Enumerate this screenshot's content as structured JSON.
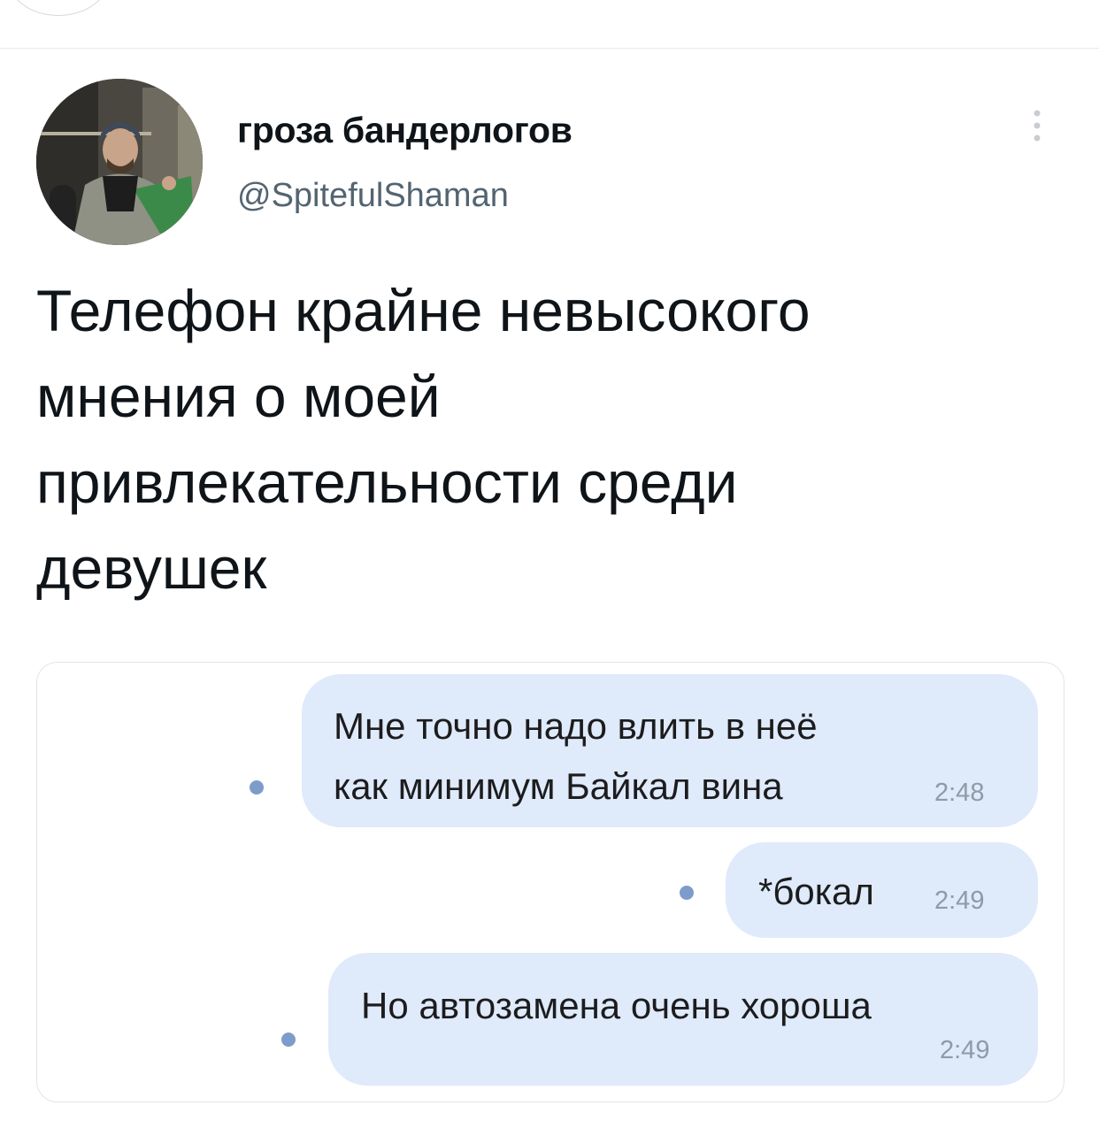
{
  "tweet": {
    "author": {
      "display_name": "гроза бандерлогов",
      "handle": "@SpitefulShaman"
    },
    "text_lines": [
      "Телефон крайне невысокого",
      "мнения о моей",
      "привлекательности среди",
      "девушек"
    ],
    "more_icon": "more-vertical-icon"
  },
  "chat": {
    "bubble_color": "#dfeafa",
    "dot_color": "#7d9ccb",
    "messages": [
      {
        "lines": [
          "Мне точно надо влить в неё",
          "как минимум Байкал вина"
        ],
        "time": "2:48"
      },
      {
        "lines": [
          "*бокал"
        ],
        "time": "2:49"
      },
      {
        "lines": [
          "Но автозамена очень хороша"
        ],
        "time": "2:49"
      }
    ]
  }
}
